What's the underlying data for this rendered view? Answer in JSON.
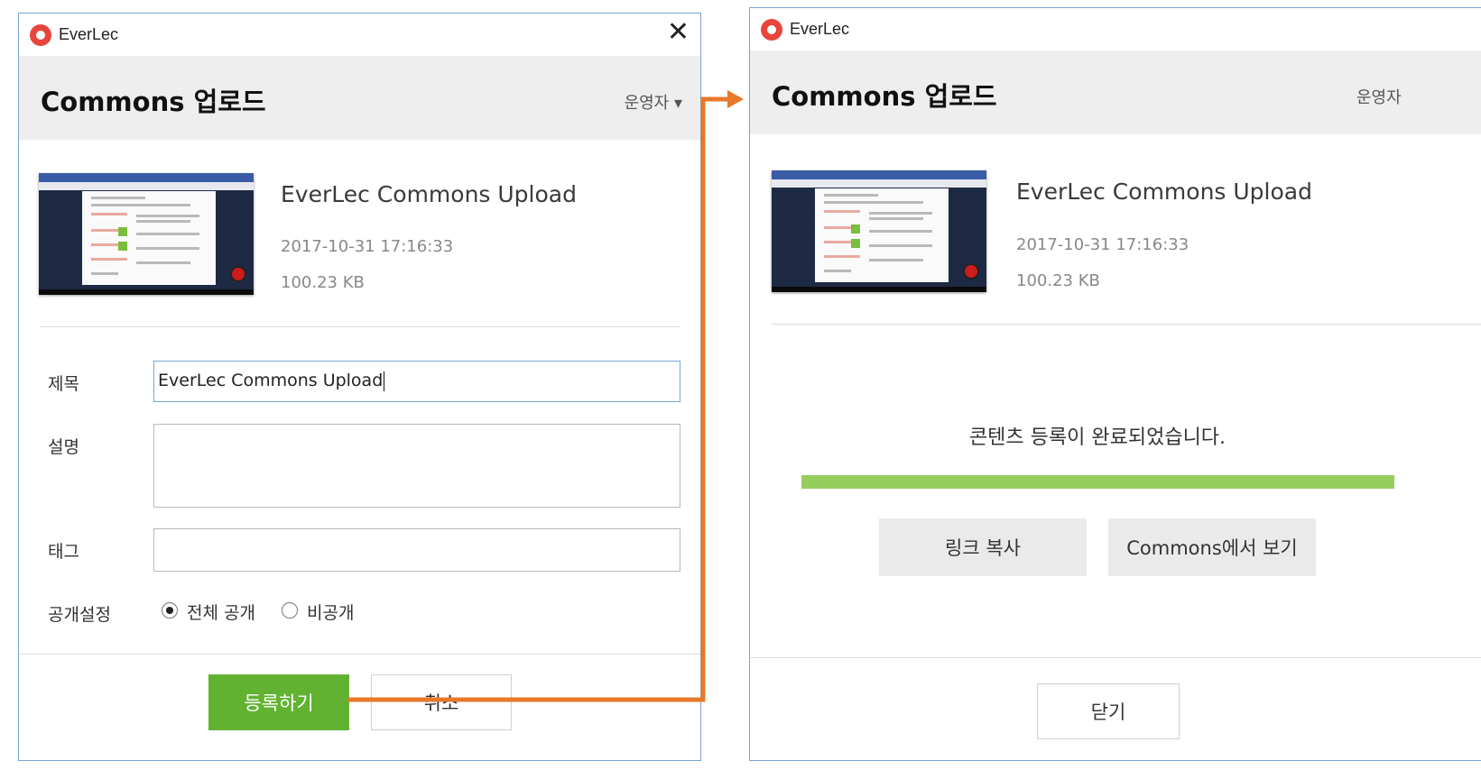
{
  "app": {
    "name": "EverLec"
  },
  "colors": {
    "accent_green": "#62b231",
    "progress_green": "#97cd5e",
    "arrow_orange": "#e8782a",
    "brand_red": "#e8453c"
  },
  "icons": {
    "app": "everlec-logo-icon",
    "close": "close-icon",
    "dropdown": "chevron-down-icon",
    "arrow": "orange-flow-arrow"
  },
  "upload_dialog": {
    "close": "✕",
    "header": {
      "title": "Commons 업로드",
      "operator_label": "운영자 ▾"
    },
    "file": {
      "title": "EverLec Commons Upload",
      "date": "2017-10-31 17:16:33",
      "size": "100.23 KB"
    },
    "form": {
      "title_label": "제목",
      "title_value": "EverLec Commons Upload",
      "description_label": "설명",
      "description_value": "",
      "tag_label": "태그",
      "tag_value": "",
      "visibility_label": "공개설정",
      "visibility_options": [
        {
          "label": "전체 공개",
          "checked": true
        },
        {
          "label": "비공개",
          "checked": false
        }
      ]
    },
    "buttons": {
      "register": "등록하기",
      "cancel": "취소"
    }
  },
  "complete_dialog": {
    "close": "✕",
    "header": {
      "title": "Commons 업로드",
      "operator_label": "운영자"
    },
    "file": {
      "title": "EverLec Commons Upload",
      "date": "2017-10-31 17:16:33",
      "size": "100.23 KB"
    },
    "message": "콘텐츠 등록이 완료되었습니다.",
    "progress_fraction": 1.0,
    "buttons": {
      "copy_link": "링크 복사",
      "view_in_commons": "Commons에서 보기",
      "close": "닫기"
    }
  }
}
